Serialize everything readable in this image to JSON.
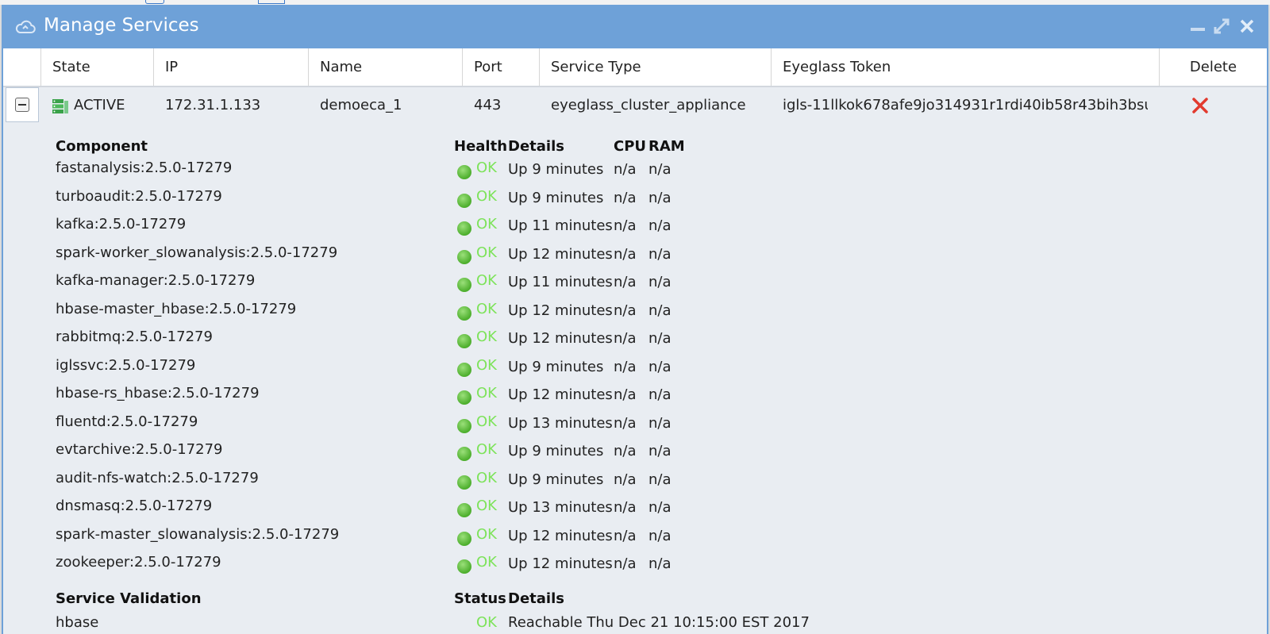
{
  "window": {
    "title": "Manage Services",
    "icon": "cloud-icon"
  },
  "table": {
    "headers": [
      "State",
      "IP",
      "Name",
      "Port",
      "Service Type",
      "Eyeglass Token",
      "Delete"
    ],
    "row": {
      "state": "ACTIVE",
      "ip": "172.31.1.133",
      "name": "demoeca_1",
      "port": "443",
      "service_type": "eyeglass_cluster_appliance",
      "token": "igls-11llkok678afe9jo314931r1rdi40ib58r43bih3bsu..."
    }
  },
  "detail": {
    "component_header": "Component",
    "health_header": "Health",
    "details_header": "Details",
    "cpu_header": "CPU",
    "ram_header": "RAM",
    "components": [
      {
        "name": "fastanalysis:2.5.0-17279",
        "health": "OK",
        "details": "Up 9 minutes",
        "cpu": "n/a",
        "ram": "n/a"
      },
      {
        "name": "turboaudit:2.5.0-17279",
        "health": "OK",
        "details": "Up 9 minutes",
        "cpu": "n/a",
        "ram": "n/a"
      },
      {
        "name": "kafka:2.5.0-17279",
        "health": "OK",
        "details": "Up 11 minutes",
        "cpu": "n/a",
        "ram": "n/a"
      },
      {
        "name": "spark-worker_slowanalysis:2.5.0-17279",
        "health": "OK",
        "details": "Up 12 minutes",
        "cpu": "n/a",
        "ram": "n/a"
      },
      {
        "name": "kafka-manager:2.5.0-17279",
        "health": "OK",
        "details": "Up 11 minutes",
        "cpu": "n/a",
        "ram": "n/a"
      },
      {
        "name": "hbase-master_hbase:2.5.0-17279",
        "health": "OK",
        "details": "Up 12 minutes",
        "cpu": "n/a",
        "ram": "n/a"
      },
      {
        "name": "rabbitmq:2.5.0-17279",
        "health": "OK",
        "details": "Up 12 minutes",
        "cpu": "n/a",
        "ram": "n/a"
      },
      {
        "name": "iglssvc:2.5.0-17279",
        "health": "OK",
        "details": "Up 9 minutes",
        "cpu": "n/a",
        "ram": "n/a"
      },
      {
        "name": "hbase-rs_hbase:2.5.0-17279",
        "health": "OK",
        "details": "Up 12 minutes",
        "cpu": "n/a",
        "ram": "n/a"
      },
      {
        "name": "fluentd:2.5.0-17279",
        "health": "OK",
        "details": "Up 13 minutes",
        "cpu": "n/a",
        "ram": "n/a"
      },
      {
        "name": "evtarchive:2.5.0-17279",
        "health": "OK",
        "details": "Up 9 minutes",
        "cpu": "n/a",
        "ram": "n/a"
      },
      {
        "name": "audit-nfs-watch:2.5.0-17279",
        "health": "OK",
        "details": "Up 9 minutes",
        "cpu": "n/a",
        "ram": "n/a"
      },
      {
        "name": "dnsmasq:2.5.0-17279",
        "health": "OK",
        "details": "Up 13 minutes",
        "cpu": "n/a",
        "ram": "n/a"
      },
      {
        "name": "spark-master_slowanalysis:2.5.0-17279",
        "health": "OK",
        "details": "Up 12 minutes",
        "cpu": "n/a",
        "ram": "n/a"
      },
      {
        "name": "zookeeper:2.5.0-17279",
        "health": "OK",
        "details": "Up 12 minutes",
        "cpu": "n/a",
        "ram": "n/a"
      }
    ],
    "validation_header": "Service Validation",
    "status_header": "Status",
    "status_details_header": "Details",
    "partial_row": {
      "name": "hbase",
      "status": "OK",
      "details": "Reachable Thu Dec 21 10:15:00 EST 2017"
    }
  },
  "colors": {
    "titlebar": "#6ea1d8",
    "ok_text": "#7de35a",
    "delete": "#e23a2e"
  }
}
